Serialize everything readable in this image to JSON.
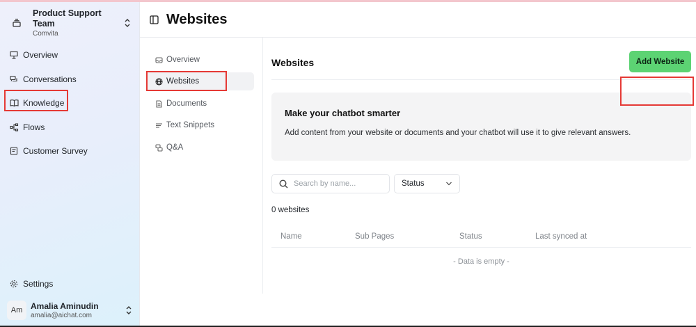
{
  "team": {
    "name": "Product Support Team",
    "org": "Comvita"
  },
  "sidebar": {
    "items": [
      {
        "label": "Overview",
        "icon": "presentation-icon"
      },
      {
        "label": "Conversations",
        "icon": "chat-bubbles-icon"
      },
      {
        "label": "Knowledge",
        "icon": "book-open-icon"
      },
      {
        "label": "Flows",
        "icon": "flow-icon"
      },
      {
        "label": "Customer Survey",
        "icon": "survey-icon"
      }
    ],
    "settings_label": "Settings"
  },
  "user": {
    "initials": "Am",
    "name": "Amalia Aminudin",
    "email": "amalia@aichat.com"
  },
  "header": {
    "title": "Websites"
  },
  "subnav": {
    "items": [
      {
        "label": "Overview",
        "icon": "inbox-icon"
      },
      {
        "label": "Websites",
        "icon": "globe-icon",
        "active": true
      },
      {
        "label": "Documents",
        "icon": "document-icon"
      },
      {
        "label": "Text Snippets",
        "icon": "text-lines-icon"
      },
      {
        "label": "Q&A",
        "icon": "qa-icon"
      }
    ]
  },
  "main": {
    "title": "Websites",
    "add_button_label": "Add Website",
    "info": {
      "title": "Make your chatbot smarter",
      "text": "Add content from your website or documents and your chatbot will use it to give relevant answers."
    },
    "search": {
      "placeholder": "Search by name..."
    },
    "status_filter": {
      "selected": "Status"
    },
    "count_text": "0 websites",
    "table": {
      "columns": [
        "Name",
        "Sub Pages",
        "Status",
        "Last synced at"
      ],
      "empty_text": "- Data is empty -"
    }
  },
  "colors": {
    "accent_green": "#5cd373",
    "annotation_red": "#e53935"
  }
}
